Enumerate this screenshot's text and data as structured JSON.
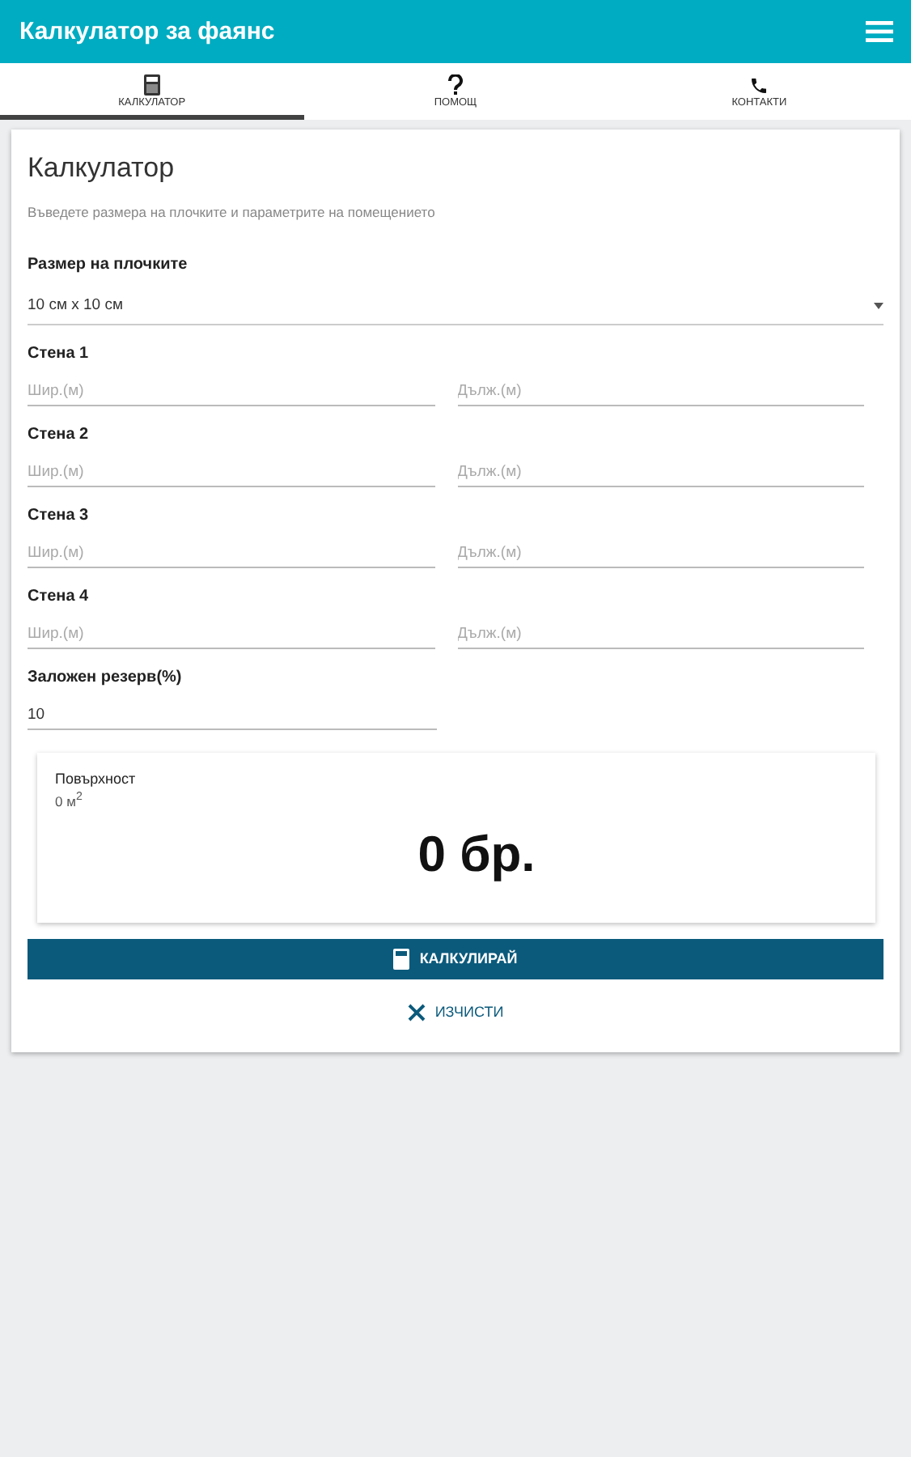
{
  "app_bar": {
    "title": "Калкулатор за фаянс"
  },
  "tabs": [
    {
      "label": "КАЛКУЛАТОР",
      "kind": "calculator",
      "selected": true
    },
    {
      "label": "ПОМОЩ",
      "kind": "question",
      "selected": false
    },
    {
      "label": "КОНТАКТИ",
      "kind": "phone",
      "selected": false
    }
  ],
  "card": {
    "title": "Калкулатор",
    "subtitle": "Въведете размера на плочките и параметрите на помещението",
    "tile_size": {
      "label": "Размер на плочките",
      "value": "10 см x 10 см"
    },
    "walls": [
      {
        "label": "Стена 1",
        "width_placeholder": "Шир.(м)",
        "length_placeholder": "Дълж.(м)"
      },
      {
        "label": "Стена 2",
        "width_placeholder": "Шир.(м)",
        "length_placeholder": "Дълж.(м)"
      },
      {
        "label": "Стена 3",
        "width_placeholder": "Шир.(м)",
        "length_placeholder": "Дълж.(м)"
      },
      {
        "label": "Стена 4",
        "width_placeholder": "Шир.(м)",
        "length_placeholder": "Дълж.(м)"
      }
    ],
    "reserve": {
      "label": "Заложен резерв(%)",
      "value": "10"
    },
    "result": {
      "label": "Повърхност",
      "area": "0 м$^{2}$",
      "count": "0 бр."
    },
    "calculate_button": "КАЛКУЛИРАЙ",
    "clear_button": "ИЗЧИСТИ"
  }
}
